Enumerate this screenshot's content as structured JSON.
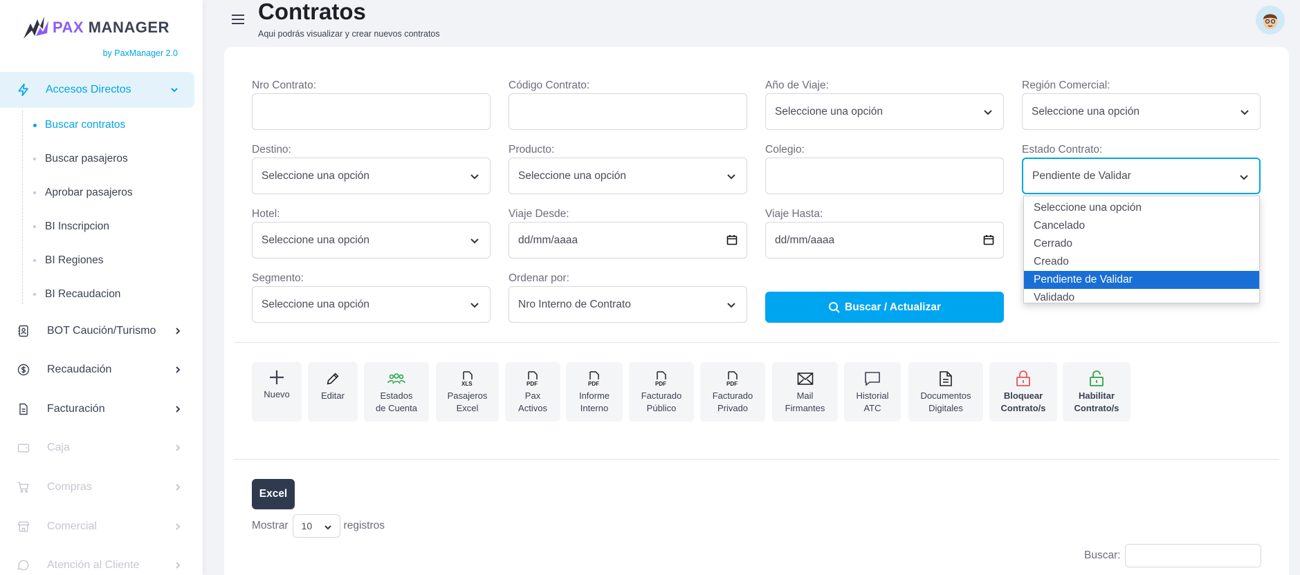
{
  "brand": {
    "name_part1": "PAX",
    "name_part2": "MANAGER",
    "subtitle": "by PaxManager 2.0",
    "accent": "#00a5e5",
    "logo_color": "#8b5cf6"
  },
  "sidebar": {
    "active_group": {
      "label": "Accesos Directos",
      "icon": "lightning-icon"
    },
    "sub_items": [
      {
        "label": "Buscar contratos",
        "active": true
      },
      {
        "label": "Buscar pasajeros"
      },
      {
        "label": "Aprobar pasajeros"
      },
      {
        "label": "BI Inscripcion"
      },
      {
        "label": "BI Regiones"
      },
      {
        "label": "BI Recaudacion"
      }
    ],
    "groups": [
      {
        "label": "BOT Caución/Turismo",
        "icon": "contact-book-icon",
        "disabled": false
      },
      {
        "label": "Recaudación",
        "icon": "dollar-circle-icon",
        "disabled": false
      },
      {
        "label": "Facturación",
        "icon": "document-icon",
        "disabled": false
      },
      {
        "label": "Caja",
        "icon": "wallet-icon",
        "disabled": true
      },
      {
        "label": "Compras",
        "icon": "cart-icon",
        "disabled": true
      },
      {
        "label": "Comercial",
        "icon": "store-icon",
        "disabled": true
      },
      {
        "label": "Atención al Cliente",
        "icon": "chat-bubble-icon",
        "disabled": true
      }
    ]
  },
  "header": {
    "title": "Contratos",
    "subtitle": "Aqui podrás visualizar y crear nuevos contratos"
  },
  "filters": {
    "nro_contrato": {
      "label": "Nro Contrato:",
      "value": ""
    },
    "codigo_contrato": {
      "label": "Código Contrato:",
      "value": ""
    },
    "anio_viaje": {
      "label": "Año de Viaje:",
      "value": "Seleccione una opción"
    },
    "region_comercial": {
      "label": "Región Comercial:",
      "value": "Seleccione una opción"
    },
    "destino": {
      "label": "Destino:",
      "value": "Seleccione una opción"
    },
    "producto": {
      "label": "Producto:",
      "value": "Seleccione una opción"
    },
    "colegio": {
      "label": "Colegio:",
      "value": ""
    },
    "estado_contrato": {
      "label": "Estado Contrato:",
      "value": "Pendiente de Validar"
    },
    "hotel": {
      "label": "Hotel:",
      "value": "Seleccione una opción"
    },
    "viaje_desde": {
      "label": "Viaje Desde:",
      "value": "dd/mm/aaaa"
    },
    "viaje_hasta": {
      "label": "Viaje Hasta:",
      "value": "dd/mm/aaaa"
    },
    "segmento": {
      "label": "Segmento:",
      "value": "Seleccione una opción"
    },
    "ordenar_por": {
      "label": "Ordenar por:",
      "value": "Nro Interno de Contrato"
    }
  },
  "estado_options": [
    "Seleccione una opción",
    "Cancelado",
    "Cerrado",
    "Creado",
    "Pendiente de Validar",
    "Validado"
  ],
  "estado_selected_index": 4,
  "search_button": {
    "label": "Buscar / Actualizar",
    "color": "#00a5f0"
  },
  "toolbar": [
    {
      "line1": "Nuevo",
      "line2": "",
      "icon": "plus-icon"
    },
    {
      "line1": "Editar",
      "line2": "",
      "icon": "pencil-icon"
    },
    {
      "line1": "Estados",
      "line2": "de Cuenta",
      "icon": "users-group-icon"
    },
    {
      "line1": "Pasajeros",
      "line2": "Excel",
      "icon": "xls-file-icon"
    },
    {
      "line1": "Pax",
      "line2": "Activos",
      "icon": "pdf-file-icon"
    },
    {
      "line1": "Informe",
      "line2": "Interno",
      "icon": "pdf-file-icon"
    },
    {
      "line1": "Facturado",
      "line2": "Público",
      "icon": "pdf-file-icon"
    },
    {
      "line1": "Facturado",
      "line2": "Privado",
      "icon": "pdf-file-icon"
    },
    {
      "line1": "Mail",
      "line2": "Firmantes",
      "icon": "envelope-icon"
    },
    {
      "line1": "Historial",
      "line2": "ATC",
      "icon": "message-icon"
    },
    {
      "line1": "Documentos",
      "line2": "Digitales",
      "icon": "document-text-icon"
    },
    {
      "line1": "Bloquear",
      "line2": "Contrato/s",
      "icon": "lock-icon",
      "color": "#ea5455"
    },
    {
      "line1": "Habilitar",
      "line2": "Contrato/s",
      "icon": "unlock-icon",
      "color": "#28a745"
    }
  ],
  "table_controls": {
    "excel_label": "Excel",
    "show_label": "Mostrar",
    "page_size": "10",
    "records_label": "registros",
    "search_label": "Buscar:"
  }
}
